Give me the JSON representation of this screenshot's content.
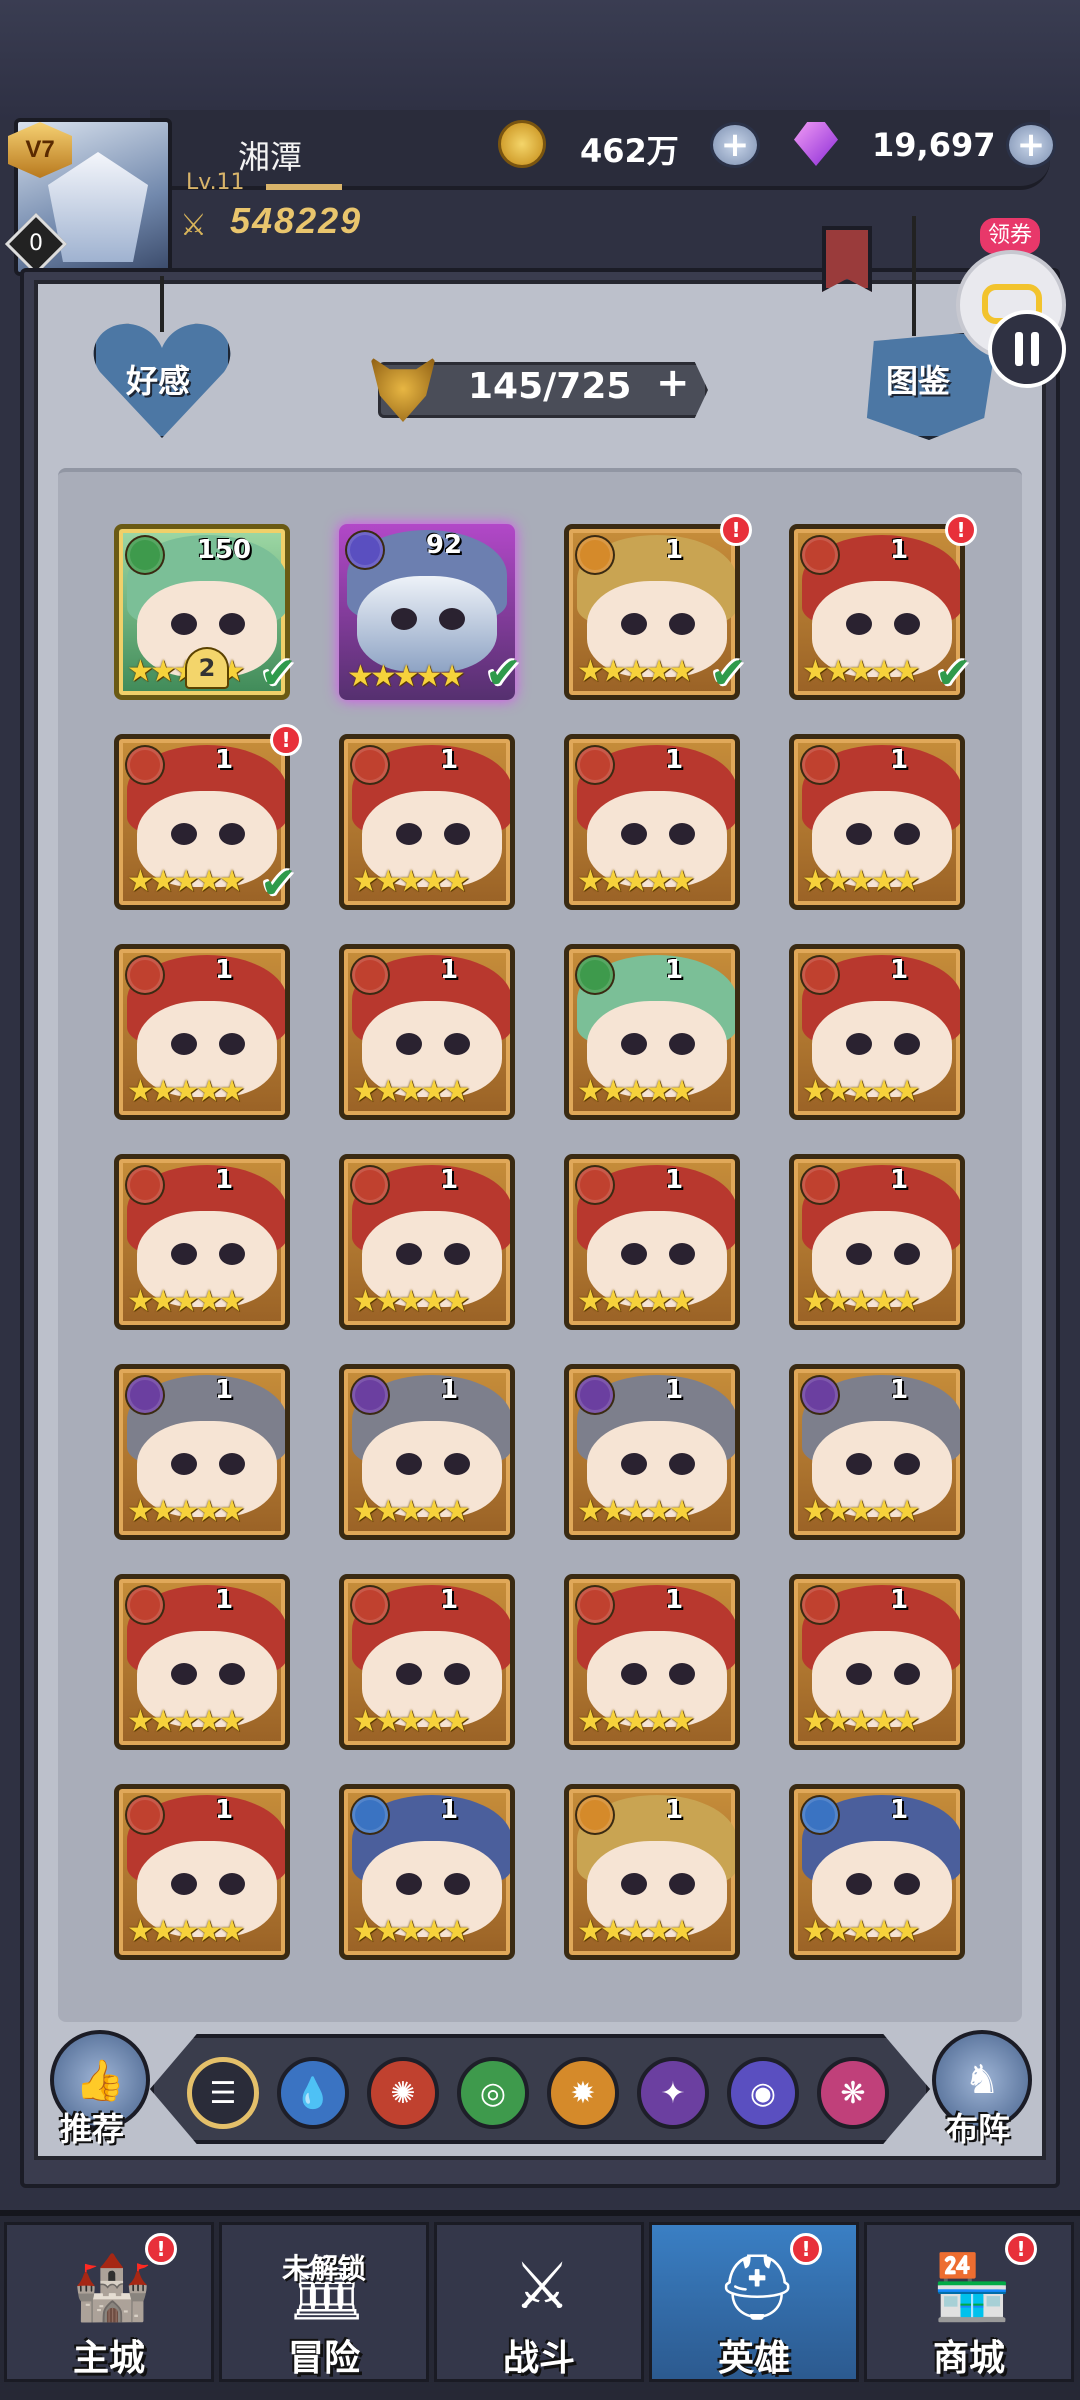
{
  "player": {
    "name": "湘潭",
    "level": "Lv.11",
    "vip": "V7",
    "badge_count": "0",
    "power": "548229"
  },
  "currency": {
    "gold": "462万",
    "gems": "19,697"
  },
  "header": {
    "affection_label": "好感",
    "codex_label": "图鉴",
    "hero_count": "145/725"
  },
  "floating": {
    "coupon_label": "领券"
  },
  "heroes": [
    {
      "level": "150",
      "stars": "★★★★★",
      "element": "wind",
      "star_badge": "2",
      "checked": true
    },
    {
      "level": "92",
      "stars": "★★★★★",
      "element": "void",
      "checked": true
    },
    {
      "level": "1",
      "stars": "★★★★★",
      "element": "light",
      "checked": true,
      "alert": true
    },
    {
      "level": "1",
      "stars": "★★★★★",
      "element": "fire",
      "checked": true,
      "alert": true
    },
    {
      "level": "1",
      "stars": "★★★★★",
      "element": "fire",
      "checked": true,
      "alert": true
    },
    {
      "level": "1",
      "stars": "★★★★★",
      "element": "fire"
    },
    {
      "level": "1",
      "stars": "★★★★★",
      "element": "fire"
    },
    {
      "level": "1",
      "stars": "★★★★★",
      "element": "fire"
    },
    {
      "level": "1",
      "stars": "★★★★★",
      "element": "fire"
    },
    {
      "level": "1",
      "stars": "★★★★★",
      "element": "fire"
    },
    {
      "level": "1",
      "stars": "★★★★★",
      "element": "wind"
    },
    {
      "level": "1",
      "stars": "★★★★★",
      "element": "fire"
    },
    {
      "level": "1",
      "stars": "★★★★★",
      "element": "fire"
    },
    {
      "level": "1",
      "stars": "★★★★★",
      "element": "fire"
    },
    {
      "level": "1",
      "stars": "★★★★★",
      "element": "fire"
    },
    {
      "level": "1",
      "stars": "★★★★★",
      "element": "fire"
    },
    {
      "level": "1",
      "stars": "★★★★★",
      "element": "dark"
    },
    {
      "level": "1",
      "stars": "★★★★★",
      "element": "dark"
    },
    {
      "level": "1",
      "stars": "★★★★★",
      "element": "dark"
    },
    {
      "level": "1",
      "stars": "★★★★★",
      "element": "dark"
    },
    {
      "level": "1",
      "stars": "★★★★★",
      "element": "fire"
    },
    {
      "level": "1",
      "stars": "★★★★★",
      "element": "fire"
    },
    {
      "level": "1",
      "stars": "★★★★★",
      "element": "fire"
    },
    {
      "level": "1",
      "stars": "★★★★★",
      "element": "fire"
    },
    {
      "level": "1",
      "stars": "★★★★★",
      "element": "fire"
    },
    {
      "level": "1",
      "stars": "★★★★★",
      "element": "water"
    },
    {
      "level": "1",
      "stars": "★★★★★",
      "element": "light"
    },
    {
      "level": "1",
      "stars": "★★★★★",
      "element": "water"
    }
  ],
  "filters": [
    "all",
    "water",
    "fire",
    "wind",
    "light",
    "dark",
    "void",
    "divine"
  ],
  "side": {
    "recommend_label": "推荐",
    "formation_label": "布阵"
  },
  "nav": [
    {
      "label": "主城",
      "alert": true
    },
    {
      "label": "冒险",
      "lock_text": "未解锁"
    },
    {
      "label": "战斗"
    },
    {
      "label": "英雄",
      "alert": true,
      "active": true
    },
    {
      "label": "商城",
      "alert": true
    }
  ],
  "colors": {
    "fire": "#c0412f",
    "water": "#3a73c2",
    "wind": "#3e9a4c",
    "light": "#d58a2a",
    "dark": "#6b3fa0",
    "void": "#5a4fc0",
    "divine": "#c0407a",
    "all": "#2a2c39"
  }
}
